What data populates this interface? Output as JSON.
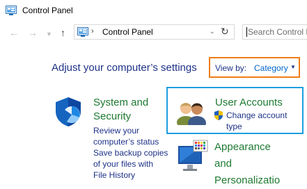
{
  "window": {
    "title": "Control Panel",
    "icon": "control-panel-icon"
  },
  "nav": {
    "back_icon": "back-arrow-icon",
    "forward_icon": "forward-arrow-icon",
    "recent_icon": "chevron-down-icon",
    "up_icon": "up-arrow-icon"
  },
  "address": {
    "path": "Control Panel",
    "icon": "control-panel-icon",
    "refresh_icon": "refresh-icon"
  },
  "search": {
    "placeholder": "Search Control Panel",
    "value": ""
  },
  "main": {
    "heading": "Adjust your computer’s settings",
    "view_by": {
      "label": "View by:",
      "value": "Category"
    }
  },
  "categories": [
    {
      "title_line1": "System and",
      "title_line2": "Security",
      "links": [
        "Review your",
        "computer’s status",
        "Save backup copies",
        "of your files with",
        "File History"
      ],
      "icon": "shield-icon"
    },
    {
      "title": "User Accounts",
      "links": [
        "Change account",
        "type"
      ],
      "icon": "users-icon",
      "link_icon": "uac-shield-icon"
    },
    {
      "title_line1": "Appearance",
      "title_line2": "and",
      "title_line3": "Personalizatio",
      "icon": "monitor-icon"
    }
  ],
  "colors": {
    "highlight_view_by": "#f07d17",
    "highlight_user_accounts": "#1c9ee0",
    "link": "#1e3287",
    "category_title": "#1e7a32"
  }
}
